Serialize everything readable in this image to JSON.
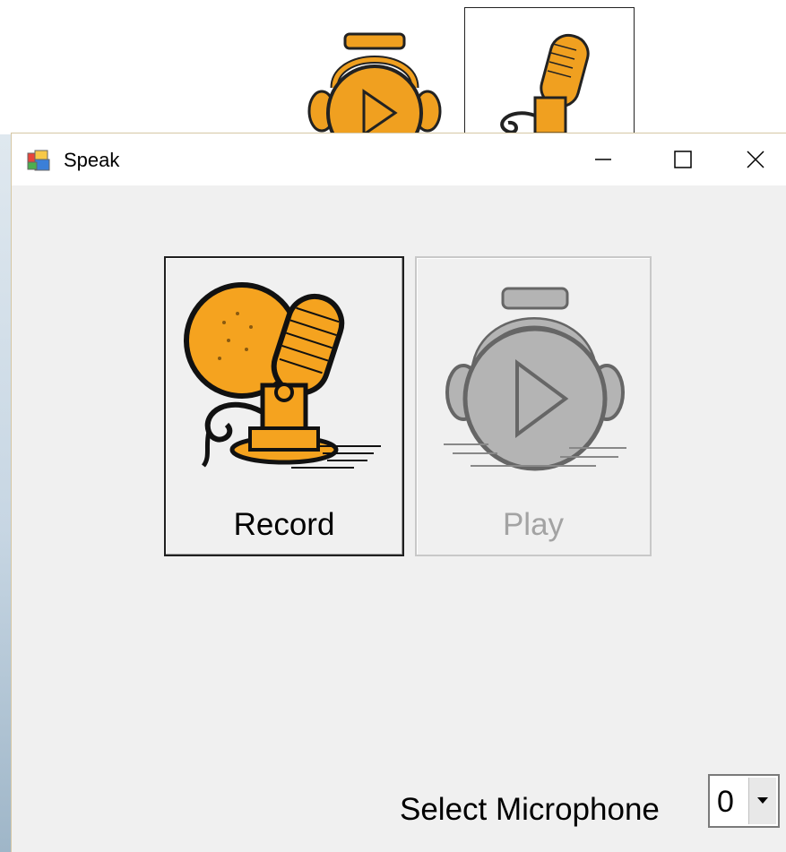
{
  "window": {
    "title": "Speak",
    "icon": "app-window-icon",
    "controls": {
      "minimize": "minimize-icon",
      "maximize": "maximize-icon",
      "close": "close-icon"
    }
  },
  "buttons": {
    "record": {
      "label": "Record",
      "icon": "microphone-icon",
      "enabled": true
    },
    "play": {
      "label": "Play",
      "icon": "headphones-play-icon",
      "enabled": false
    }
  },
  "microphone": {
    "label": "Select Microphone",
    "selected": "0"
  },
  "colors": {
    "accent": "#f0a020",
    "window_bg": "#f0f0f0",
    "disabled_text": "#a3a3a3"
  }
}
